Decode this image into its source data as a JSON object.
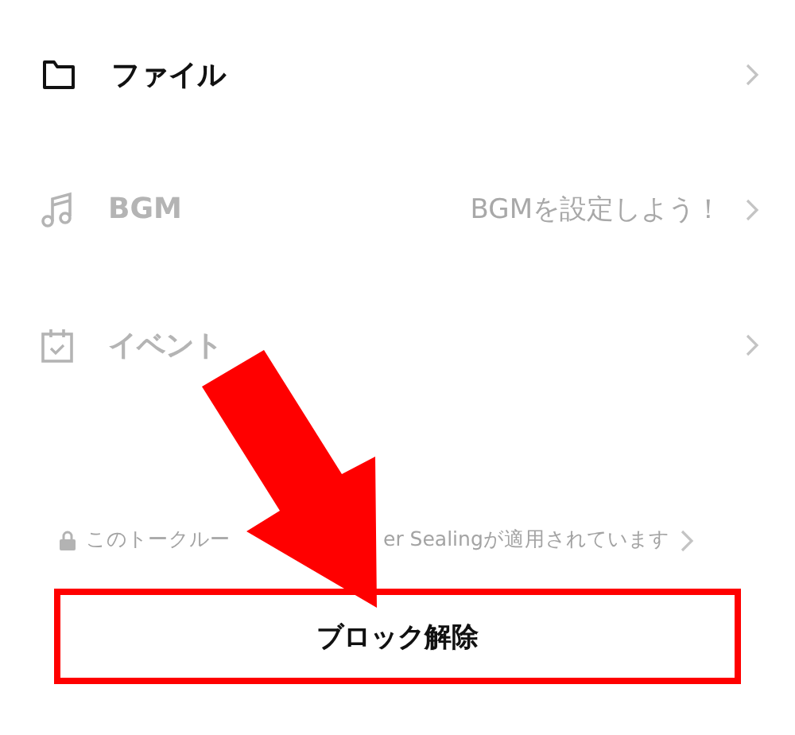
{
  "menu_items": [
    {
      "label": "ファイル",
      "disabled": false
    },
    {
      "label": "BGM",
      "value": "BGMを設定しよう！",
      "disabled": true
    },
    {
      "label": "イベント",
      "disabled": true
    }
  ],
  "notice": {
    "text_before": "このトークルー",
    "text_after": "er Sealingが適用されています"
  },
  "unblock_button": {
    "label": "ブロック解除"
  }
}
